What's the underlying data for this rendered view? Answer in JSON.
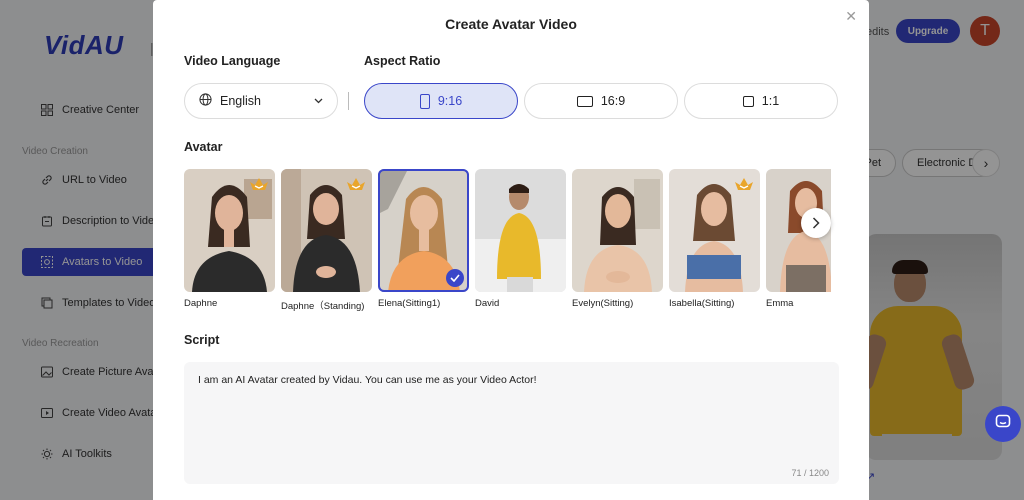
{
  "app": {
    "logo": "VidAU",
    "credits_label": "edits",
    "upgrade_label": "Upgrade",
    "user_initial": "T"
  },
  "sidebar": {
    "items": [
      {
        "label": "Creative Center",
        "icon": "grid-icon"
      },
      {
        "label": "URL to Video",
        "icon": "link-icon"
      },
      {
        "label": "Description to Video",
        "icon": "document-icon"
      },
      {
        "label": "Avatars to Video",
        "icon": "avatar-icon"
      },
      {
        "label": "Templates to Video",
        "icon": "template-icon"
      },
      {
        "label": "Create Picture Avatar",
        "icon": "image-icon"
      },
      {
        "label": "Create Video Avatar",
        "icon": "video-icon"
      },
      {
        "label": "AI Toolkits",
        "icon": "bulb-icon"
      }
    ],
    "sections": [
      "Video Creation",
      "Video Recreation"
    ]
  },
  "background_chips": [
    "Pet",
    "Electronic D"
  ],
  "modal": {
    "title": "Create Avatar Video",
    "language_label": "Video Language",
    "language_value": "English",
    "aspect_label": "Aspect Ratio",
    "ratios": [
      {
        "label": "9:16",
        "selected": true
      },
      {
        "label": "16:9",
        "selected": false
      },
      {
        "label": "1:1",
        "selected": false
      }
    ],
    "avatar_label": "Avatar",
    "avatars": [
      {
        "name": "Daphne",
        "premium": true,
        "selected": false
      },
      {
        "name": "Daphne（Standing)",
        "premium": true,
        "selected": false
      },
      {
        "name": "Elena(Sitting1)",
        "premium": false,
        "selected": true
      },
      {
        "name": "David",
        "premium": false,
        "selected": false
      },
      {
        "name": "Evelyn(Sitting)",
        "premium": false,
        "selected": false
      },
      {
        "name": "Isabella(Sitting)",
        "premium": true,
        "selected": false
      },
      {
        "name": "Emma",
        "premium": false,
        "selected": false
      }
    ],
    "script_label": "Script",
    "script_text": "I am an AI Avatar created by Vidau. You can use me as your Video Actor!",
    "script_count": "71 / 1200"
  },
  "colors": {
    "accent": "#3a46c9",
    "accent_light": "#dfe4f7",
    "premium": "#e9a52b",
    "overlay": "rgba(0,0,0,0.42)"
  }
}
